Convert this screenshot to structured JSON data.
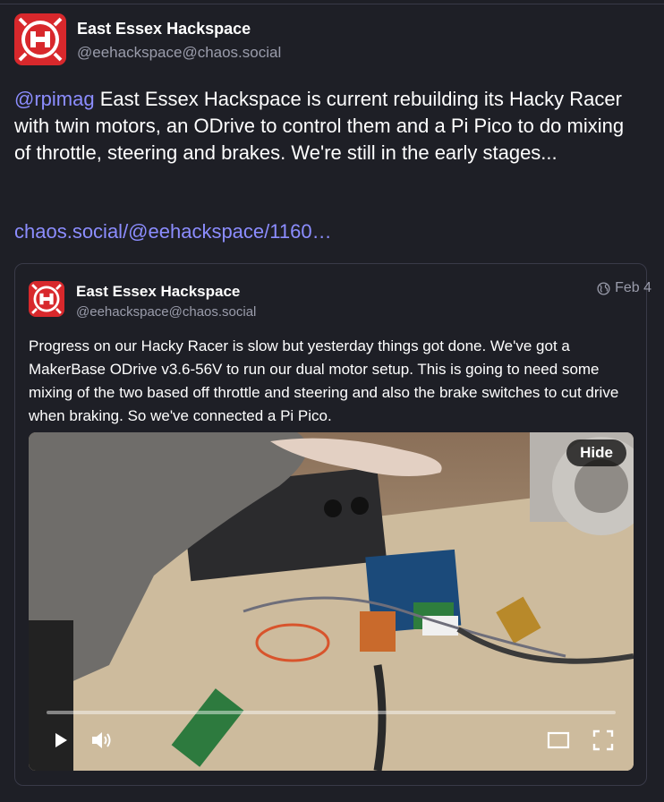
{
  "status": {
    "author": {
      "display_name": "East Essex Hackspace",
      "acct": "@eehackspace@chaos.social"
    },
    "text_mention": "@rpimag",
    "text_body": " East Essex Hackspace is current rebuilding its Hacky Racer with twin motors, an ODrive to control them and a Pi Pico to do mixing of throttle, steering and brakes. We're still in the early stages...",
    "link": "chaos.social/@eehackspace/1160…"
  },
  "quote": {
    "author": {
      "display_name": "East Essex Hackspace",
      "acct": "@eehackspace@chaos.social"
    },
    "visibility_icon": "globe-icon",
    "date": "Feb 4",
    "text": "Progress on our Hacky Racer is slow but yesterday things got done. We've got a MakerBase ODrive v3.6-56V to run our dual motor setup. This is going to need some mixing of the two based off throttle and steering and also the brake switches to cut drive when braking. So we've connected a Pi Pico.",
    "media": {
      "hide_label": "Hide",
      "progress": 0.0,
      "controls": [
        "play-icon",
        "volume-icon",
        "theater-mode-icon",
        "fullscreen-icon"
      ]
    }
  },
  "colors": {
    "background": "#1e1f26",
    "link": "#8c8dff",
    "muted": "#9a9cab",
    "border": "#393a48"
  }
}
